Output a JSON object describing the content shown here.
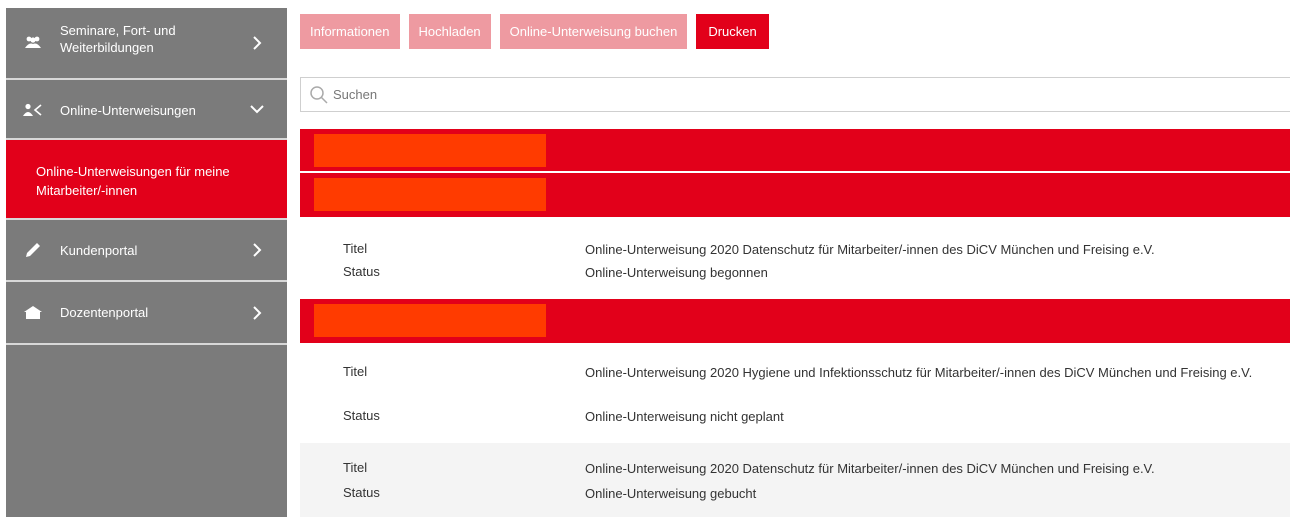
{
  "sidebar": {
    "seminare_label": "Seminare, Fort- und Weiterbildungen",
    "online_label": "Online-Unterweisungen",
    "online_sub_label": "Online-Unterweisungen für meine Mitarbeiter/-innen",
    "kunden_label": "Kundenportal",
    "dozent_label": "Dozentenportal"
  },
  "toolbar": {
    "info_label": "Informationen",
    "upload_label": "Hochladen",
    "book_label": "Online-Unterweisung buchen",
    "print_label": "Drucken"
  },
  "search": {
    "placeholder": "Suchen"
  },
  "entries": [
    {
      "title_key": "Titel",
      "title": "Online-Unterweisung 2020 Datenschutz für Mitarbeiter/-innen des DiCV München und Freising e.V.",
      "status_key": "Status",
      "status": "Online-Unterweisung begonnen"
    },
    {
      "title_key": "Titel",
      "title": "Online-Unterweisung 2020 Hygiene und Infektionsschutz für Mitarbeiter/-innen des DiCV München und Freising e.V.",
      "status_key": "Status",
      "status": "Online-Unterweisung nicht geplant"
    },
    {
      "title_key": "Titel",
      "title": "Online-Unterweisung 2020 Datenschutz für Mitarbeiter/-innen des DiCV München und Freising e.V.",
      "status_key": "Status",
      "status": "Online-Unterweisung gebucht"
    }
  ],
  "colors": {
    "accent": "#e2001a",
    "accent_light": "#ee9aa1",
    "sidebar_bg": "#7b7b7b",
    "redaction": "#ff3b00"
  },
  "icons": {
    "seminare": "people-icon",
    "online": "person-share-icon",
    "kunden": "pencil-icon",
    "dozent": "house-icon",
    "search": "search-icon"
  }
}
